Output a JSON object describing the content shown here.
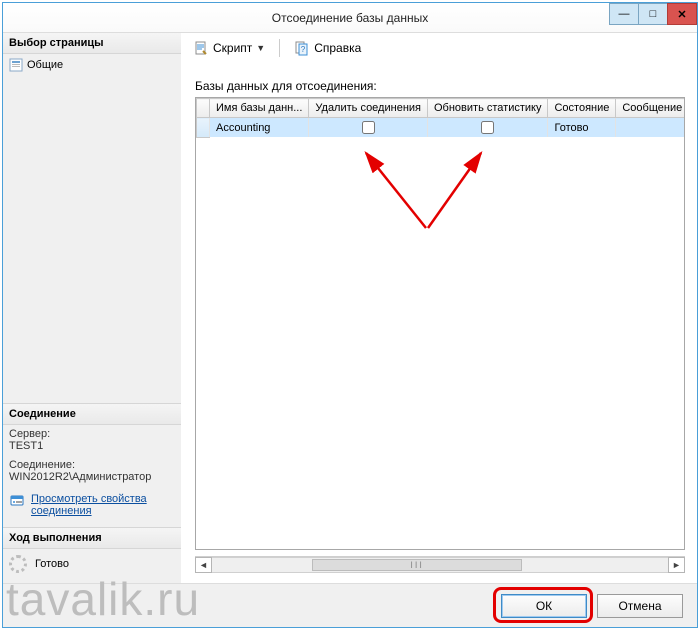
{
  "window": {
    "title": "Отсоединение базы данных",
    "minimize_glyph": "—",
    "maximize_glyph": "□",
    "close_glyph": "✕"
  },
  "sidebar": {
    "page_select_header": "Выбор страницы",
    "pages": [
      {
        "label": "Общие"
      }
    ],
    "connection_header": "Соединение",
    "server_label": "Сервер:",
    "server_value": "TEST1",
    "connection_label": "Соединение:",
    "connection_value": "WIN2012R2\\Администратор",
    "view_props_link": "Просмотреть свойства соединения",
    "progress_header": "Ход выполнения",
    "progress_status": "Готово"
  },
  "toolbar": {
    "script_label": "Скрипт",
    "help_label": "Справка"
  },
  "main": {
    "section_label": "Базы данных для отсоединения:",
    "columns": {
      "name": "Имя базы данн...",
      "drop": "Удалить соединения",
      "update": "Обновить статистику",
      "state": "Состояние",
      "message": "Сообщение"
    },
    "rows": [
      {
        "name": "Accounting",
        "drop": false,
        "update": false,
        "state": "Готово",
        "message": ""
      }
    ]
  },
  "footer": {
    "ok_label": "ОК",
    "cancel_label": "Отмена"
  },
  "watermark": "tavalik.ru"
}
